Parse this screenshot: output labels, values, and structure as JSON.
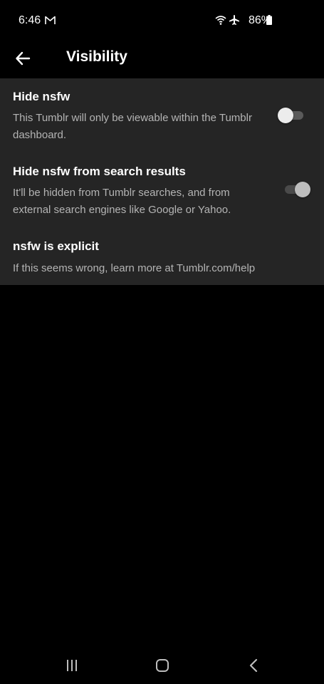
{
  "status_bar": {
    "time": "6:46",
    "battery": "86%"
  },
  "header": {
    "title": "Visibility",
    "back_icon": "arrow-left-icon"
  },
  "settings": [
    {
      "title": "Hide nsfw",
      "description": "This Tumblr will only be viewable within the Tumblr dashboard.",
      "toggle_state": "off"
    },
    {
      "title": "Hide nsfw from search results",
      "description": "It'll be hidden from Tumblr searches, and from external search engines like Google or Yahoo.",
      "toggle_state": "on-disabled"
    },
    {
      "title": "nsfw is explicit",
      "description": "If this seems wrong, learn more at Tumblr.com/help"
    }
  ],
  "nav_bar": {
    "recents_icon": "recents-icon",
    "home_icon": "home-icon",
    "back_icon": "nav-back-icon"
  },
  "colors": {
    "background": "#000000",
    "panel": "#252525",
    "secondary_text": "#b4b4b4"
  }
}
